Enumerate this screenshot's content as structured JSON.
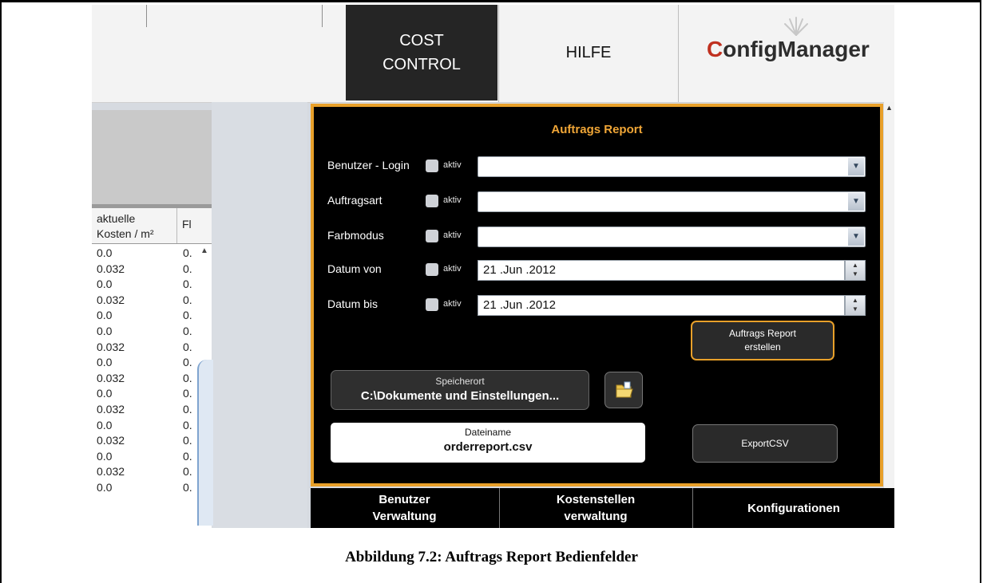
{
  "topbar": {
    "tab_cost_line1": "COST",
    "tab_cost_line2": "CONTROL",
    "tab_hilfe": "HILFE",
    "logo_c": "C",
    "logo_rest": "onfigManager"
  },
  "table": {
    "col1_line1": "aktuelle",
    "col1_line2": "Kosten / m²",
    "col2": "Fl",
    "rows": [
      [
        "0.0",
        "0."
      ],
      [
        "0.032",
        "0."
      ],
      [
        "0.0",
        "0."
      ],
      [
        "0.032",
        "0."
      ],
      [
        "0.0",
        "0."
      ],
      [
        "0.0",
        "0."
      ],
      [
        "0.032",
        "0."
      ],
      [
        "0.0",
        "0."
      ],
      [
        "0.032",
        "0."
      ],
      [
        "0.0",
        "0."
      ],
      [
        "0.032",
        "0."
      ],
      [
        "0.0",
        "0."
      ],
      [
        "0.032",
        "0."
      ],
      [
        "0.0",
        "0."
      ],
      [
        "0.032",
        "0."
      ],
      [
        "0.0",
        "0."
      ]
    ]
  },
  "report": {
    "title": "Auftrags Report",
    "fields": [
      {
        "label": "Benutzer - Login",
        "aktiv": "aktiv",
        "value": ""
      },
      {
        "label": "Auftragsart",
        "aktiv": "aktiv",
        "value": ""
      },
      {
        "label": "Farbmodus",
        "aktiv": "aktiv",
        "value": ""
      },
      {
        "label": "Datum von",
        "aktiv": "aktiv",
        "value": "21 .Jun .2012"
      },
      {
        "label": "Datum bis",
        "aktiv": "aktiv",
        "value": "21 .Jun .2012"
      }
    ],
    "create_button_line1": "Auftrags Report",
    "create_button_line2": "erstellen",
    "save_label": "Speicherort",
    "save_path": "C:\\Dokumente und Einstellungen...",
    "file_label": "Dateiname",
    "file_name": "orderreport.csv",
    "export_button": "ExportCSV"
  },
  "bottom_tabs": {
    "benutzer_line1": "Benutzer",
    "benutzer_line2": "Verwaltung",
    "kosten_line1": "Kostenstellen",
    "kosten_line2": "verwaltung",
    "konfig": "Konfigurationen"
  },
  "caption": "Abbildung 7.2: Auftrags Report Bedienfelder",
  "colors": {
    "accent": "#e8a02a",
    "panel_bg": "#000000",
    "logo_red": "#c0301f"
  }
}
